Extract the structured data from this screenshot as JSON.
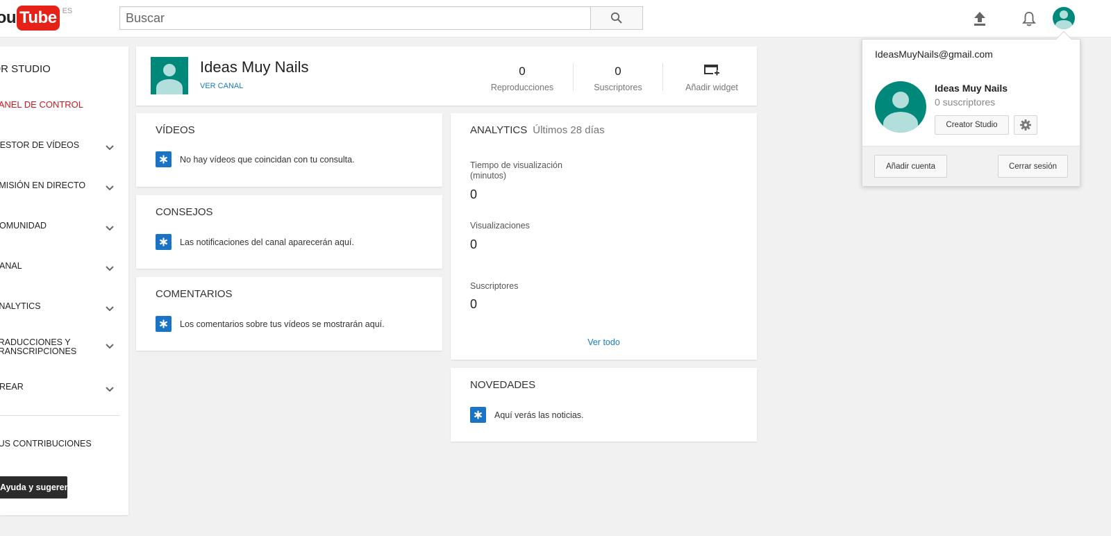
{
  "header": {
    "logo_you": "You",
    "logo_tube": "Tube",
    "logo_country": "ES",
    "search_placeholder": "Buscar",
    "icons": {
      "search": "search-icon",
      "upload": "upload-icon",
      "notifications": "bell-icon",
      "account": "avatar-icon"
    }
  },
  "sidebar": {
    "title": "CREATOR STUDIO",
    "active_item": "PANEL DE CONTROL",
    "items": [
      {
        "label": "GESTOR DE VÍDEOS"
      },
      {
        "label": "EMISIÓN EN DIRECTO"
      },
      {
        "label": "COMUNIDAD"
      },
      {
        "label": "CANAL"
      },
      {
        "label": "ANALYTICS"
      },
      {
        "label": "TRADUCCIONES Y",
        "label2": "TRANSCRIPCIONES"
      },
      {
        "label": "CREAR"
      }
    ],
    "contributions": "TUS CONTRIBUCIONES",
    "feedback": "Ayuda y sugerencias"
  },
  "channel": {
    "name": "Ideas Muy Nails",
    "link": "VER CANAL",
    "views_value": "0",
    "views_label": "Reproducciones",
    "subs_value": "0",
    "subs_label": "Suscriptores",
    "widget_label": "Añadir widget"
  },
  "videos": {
    "title": "VÍDEOS",
    "message": "No hay vídeos que coincidan con tu consulta."
  },
  "tips": {
    "title": "CONSEJOS",
    "message": "Las notificaciones del canal aparecerán aquí."
  },
  "comments": {
    "title": "COMENTARIOS",
    "message": "Los comentarios sobre tus vídeos se mostrarán aquí."
  },
  "analytics": {
    "title": "ANALYTICS",
    "period": "Últimos 28 días",
    "watch_time_label": "Tiempo de visualización",
    "watch_time_unit": "(minutos)",
    "watch_time_value": "0",
    "views_label": "Visualizaciones",
    "views_value": "0",
    "subs_label": "Suscriptores",
    "subs_value": "0",
    "see_all": "Ver todo"
  },
  "news": {
    "title": "NOVEDADES",
    "message": "Aquí verás las noticias."
  },
  "account_popup": {
    "email": "IdeasMuyNails@gmail.com",
    "name": "Ideas Muy Nails",
    "subscribers": "0 suscriptores",
    "creator_studio_button": "Creator Studio",
    "add_account_button": "Añadir cuenta",
    "sign_out_button": "Cerrar sesión"
  },
  "colors": {
    "accent_red": "#cc181e",
    "link_blue": "#167ac6",
    "avatar_teal": "#00897b",
    "info_blue": "#1a73c4"
  }
}
